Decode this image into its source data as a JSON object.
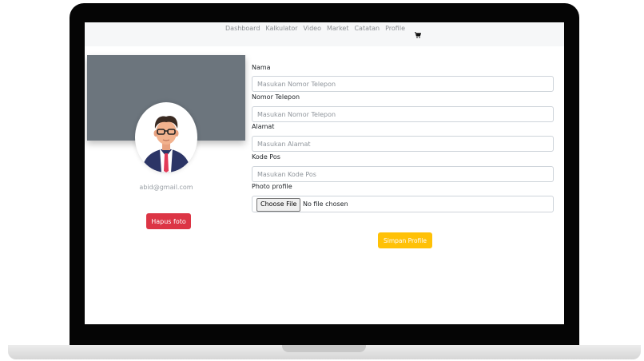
{
  "navbar": {
    "links": [
      "Dashboard",
      "Kalkulator",
      "Video",
      "Market",
      "Catatan",
      "Profile"
    ],
    "cart_icon": "shopping-cart-icon"
  },
  "profile": {
    "avatar_icon": "user-avatar-icon",
    "email": "abid@gmail.com",
    "delete_photo_label": "Hapus foto"
  },
  "form": {
    "fields": [
      {
        "label": "Nama",
        "placeholder": "Masukan Nomor Telepon"
      },
      {
        "label": "Nomor Telepon",
        "placeholder": "Masukan Nomor Telepon"
      },
      {
        "label": "Alamat",
        "placeholder": "Masukan Alamat"
      },
      {
        "label": "Kode Pos",
        "placeholder": "Masukan Kode Pos"
      }
    ],
    "photo": {
      "label": "Photo profile",
      "button_label": "Choose File",
      "status": "No file chosen"
    },
    "save_label": "Simpan Profile"
  },
  "colors": {
    "cover": "#6c757d",
    "danger": "#dc3545",
    "warning": "#ffc107",
    "navbar_bg": "#f6f7f8"
  }
}
